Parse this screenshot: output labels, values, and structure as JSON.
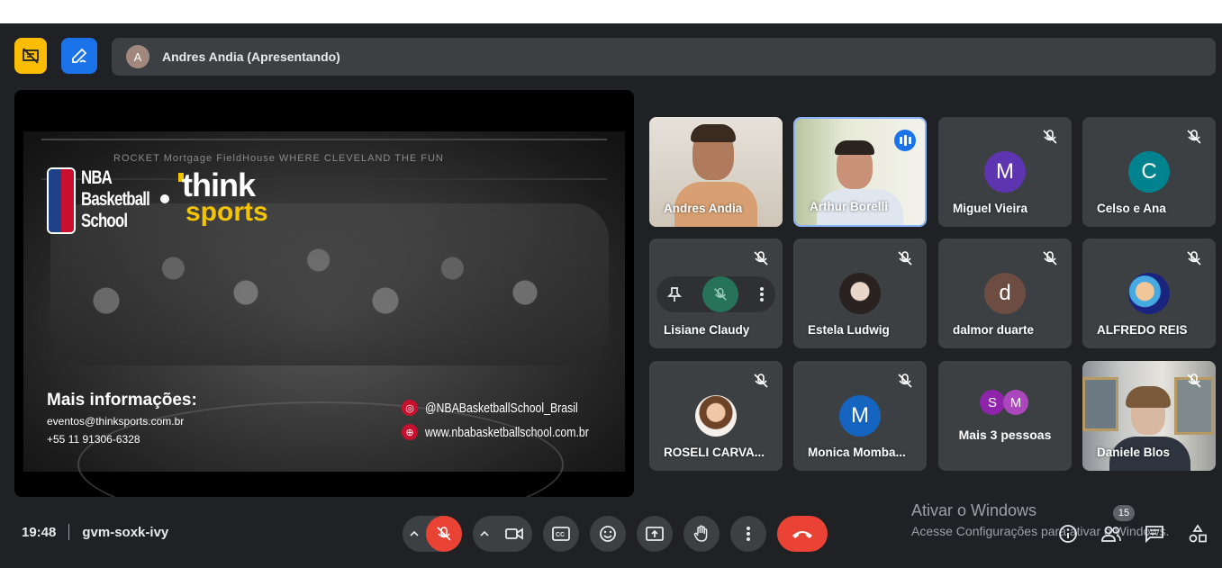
{
  "presenter": {
    "initial": "A",
    "label": "Andres Andia (Apresentando)"
  },
  "slide": {
    "logo_left": [
      "NBA",
      "Basketball",
      "School"
    ],
    "logo_right_top": "think",
    "logo_right_bottom": "sports",
    "arena_text": "ROCKET Mortgage FieldHouse          WHERE CLEVELAND          THE FUN",
    "info_title": "Mais informações:",
    "email": "eventos@thinksports.com.br",
    "phone": "+55 11 91306-6328",
    "instagram": "@NBABasketballSchool_Brasil",
    "website": "www.nbabasketballschool.com.br"
  },
  "participants": [
    {
      "name": "Andres Andia",
      "type": "video"
    },
    {
      "name": "Arthur Borelli",
      "type": "video",
      "speaking": true
    },
    {
      "name": "Miguel Vieira",
      "initial": "M",
      "color": "#5e35b1"
    },
    {
      "name": "Celso e Ana",
      "initial": "C",
      "color": "#00838f"
    },
    {
      "name": "Lisiane Claudy",
      "type": "hover"
    },
    {
      "name": "Estela Ludwig",
      "type": "photo"
    },
    {
      "name": "dalmor duarte",
      "initial": "d",
      "color": "#6d4c41"
    },
    {
      "name": "ALFREDO REIS",
      "type": "photo"
    },
    {
      "name": "ROSELI CARVA...",
      "type": "photo"
    },
    {
      "name": "Monica Momba...",
      "initial": "M",
      "color": "#1565c0"
    },
    {
      "name": "Mais 3 pessoas",
      "avatars": [
        "S",
        "M"
      ],
      "avatar_colors": [
        "#8e24aa",
        "#ab47bc"
      ]
    },
    {
      "name": "Daniele Blos",
      "type": "video"
    }
  ],
  "meeting": {
    "time": "19:48",
    "code": "gvm-soxk-ivy",
    "participant_count": "15"
  },
  "watermark": {
    "line1": "Ativar o Windows",
    "line2": "Acesse Configurações para ativar o Windows."
  },
  "colors": {
    "background": "#202124",
    "tile": "#3c4043",
    "danger": "#ea4335",
    "accent_blue": "#1a73e8",
    "accent_yellow": "#fbbc04"
  }
}
